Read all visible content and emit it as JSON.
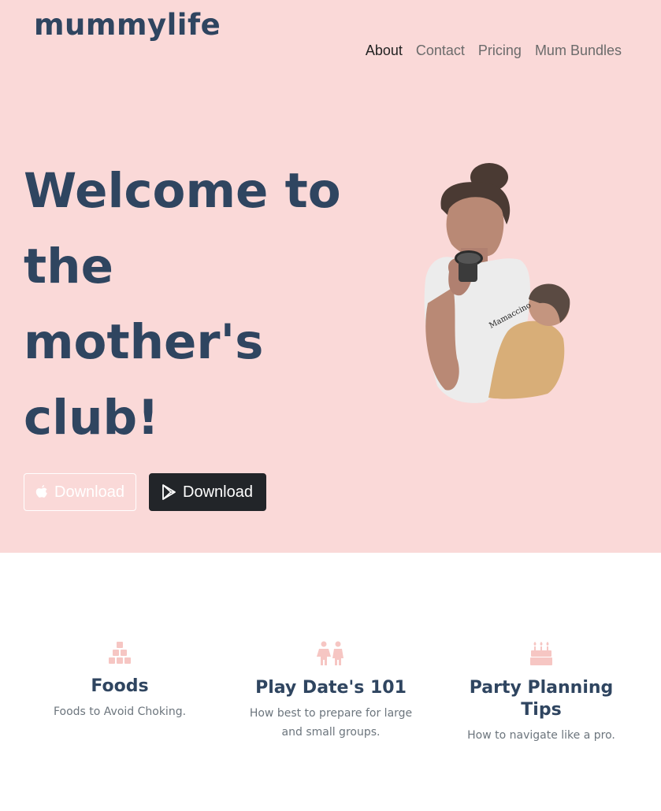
{
  "brand": "mummylife",
  "nav": {
    "items": [
      "About",
      "Contact",
      "Pricing",
      "Mum Bundles"
    ]
  },
  "hero": {
    "headline_lines": [
      "Welcome to",
      "the",
      "mother's",
      "club!"
    ],
    "illustration_text": "Mamaccino",
    "buttons": {
      "apple_label": "Download",
      "apple_icon": "apple-icon",
      "play_label": "Download",
      "play_icon": "google-play-icon"
    }
  },
  "features": [
    {
      "icon": "blocks-icon",
      "title": "Foods",
      "description": "Foods to Avoid Choking."
    },
    {
      "icon": "children-icon",
      "title": "Play Date's 101",
      "description": "How best to prepare for large and small groups."
    },
    {
      "icon": "birthday-cake-icon",
      "title": "Party Planning Tips",
      "description": "How to navigate like a pro."
    }
  ],
  "colors": {
    "hero_background": "#fad9d8",
    "brand_text": "#2f4560",
    "icon_pink": "#f6c6c3",
    "dark_button": "#222529"
  }
}
